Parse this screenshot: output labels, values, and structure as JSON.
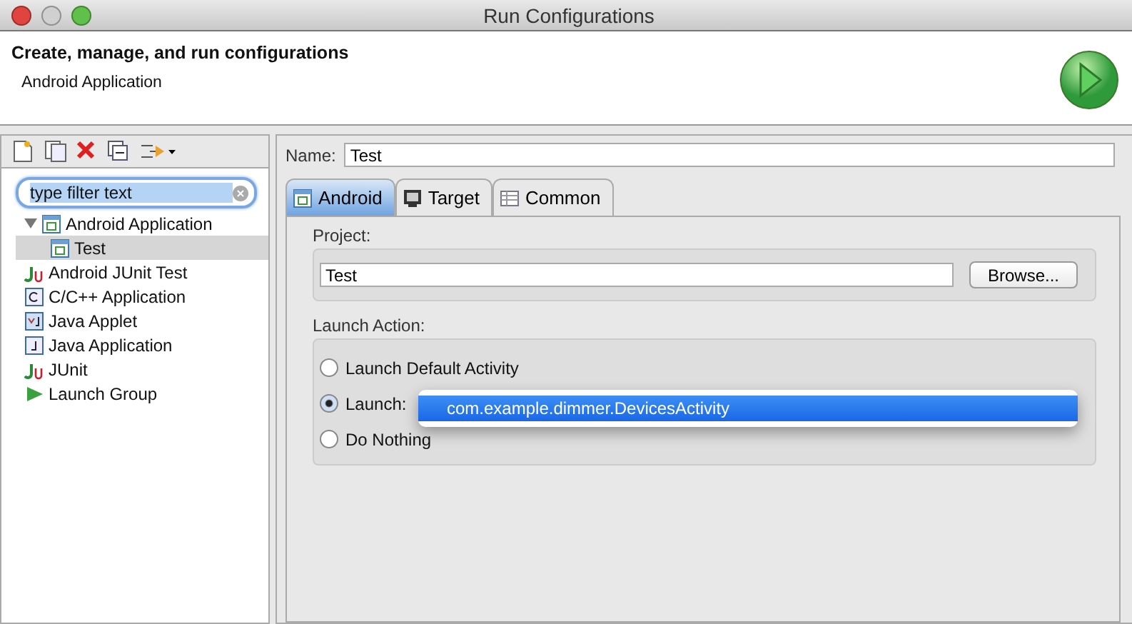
{
  "window": {
    "title": "Run Configurations"
  },
  "header": {
    "title": "Create, manage, and run configurations",
    "subtitle": "Android Application"
  },
  "filter": {
    "placeholder": "type filter text"
  },
  "tree": [
    {
      "label": "Android Application",
      "kind": "android",
      "expanded": true,
      "selected": false,
      "children": [
        {
          "label": "Test",
          "kind": "android",
          "selected": true
        }
      ]
    },
    {
      "label": "Android JUnit Test",
      "kind": "junit",
      "selected": false
    },
    {
      "label": "C/C++ Application",
      "kind": "c",
      "selected": false
    },
    {
      "label": "Java Applet",
      "kind": "applet",
      "selected": false
    },
    {
      "label": "Java Application",
      "kind": "java",
      "selected": false
    },
    {
      "label": "JUnit",
      "kind": "junit",
      "selected": false
    },
    {
      "label": "Launch Group",
      "kind": "group",
      "selected": false
    }
  ],
  "name": {
    "label": "Name:",
    "value": "Test"
  },
  "tabs": [
    {
      "label": "Android",
      "selected": true
    },
    {
      "label": "Target",
      "selected": false
    },
    {
      "label": "Common",
      "selected": false
    }
  ],
  "project": {
    "label": "Project:",
    "value": "Test",
    "button": "Browse..."
  },
  "launch_action": {
    "label": "Launch Action:",
    "options": [
      {
        "label": "Launch Default Activity",
        "selected": false
      },
      {
        "label": "Launch:",
        "selected": true
      },
      {
        "label": "Do Nothing",
        "selected": false
      }
    ],
    "popup": {
      "items": [
        {
          "label": "com.example.dimmer.DevicesActivity",
          "selected": true
        }
      ]
    }
  }
}
